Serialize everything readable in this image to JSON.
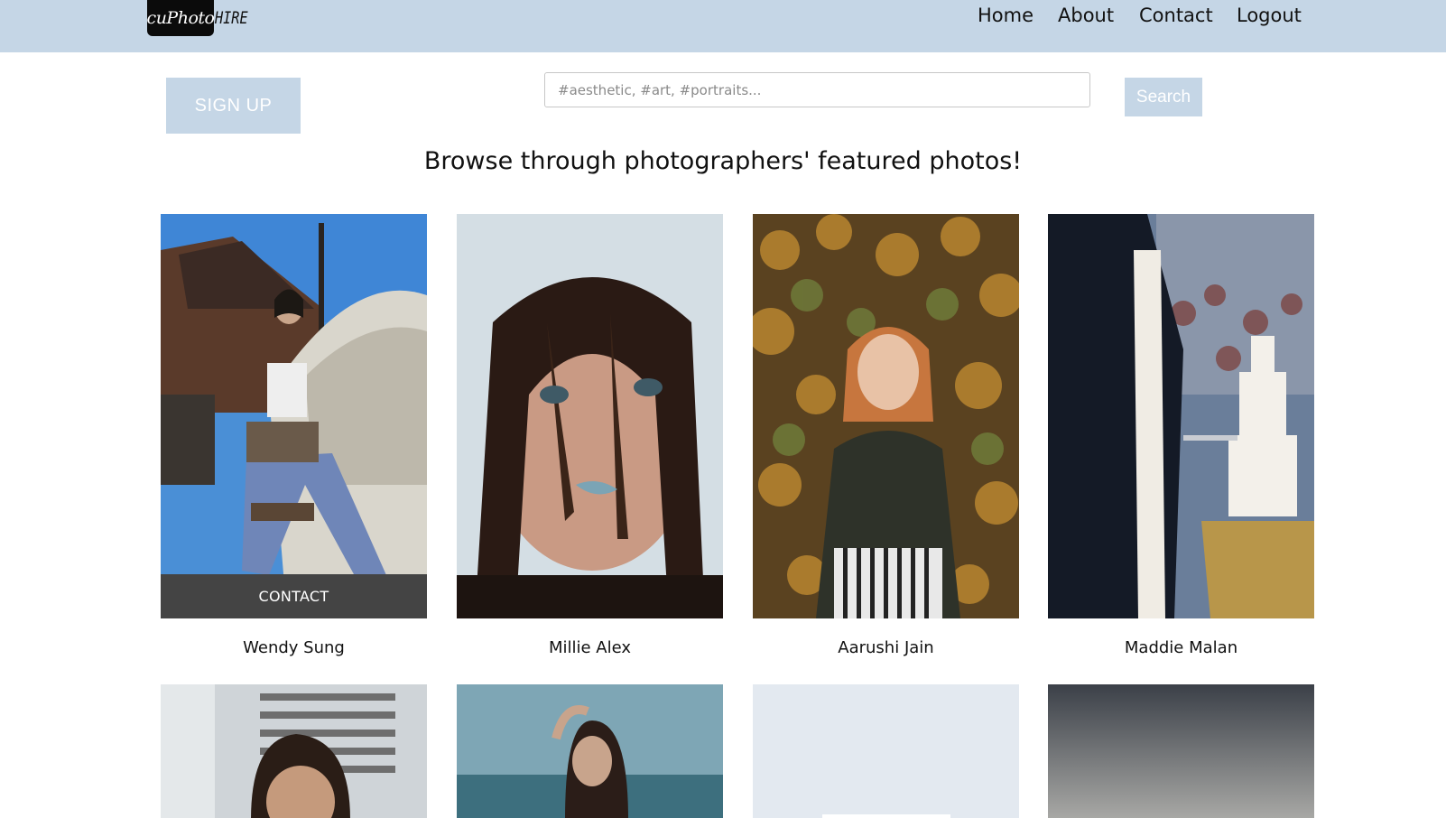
{
  "header": {
    "logo_main": "cuPhoto",
    "logo_suffix": "HIRE",
    "nav": {
      "home": "Home",
      "about": "About",
      "contact": "Contact",
      "logout": "Logout"
    }
  },
  "toolbar": {
    "signup_label": "SIGN UP",
    "search_placeholder": "#aesthetic, #art, #portraits...",
    "search_label": "Search"
  },
  "main": {
    "title": "Browse through photographers' featured photos!",
    "photographers": [
      {
        "name": "Wendy Sung",
        "action": "CONTACT"
      },
      {
        "name": "Millie Alex"
      },
      {
        "name": "Aarushi Jain"
      },
      {
        "name": "Maddie Malan"
      }
    ]
  },
  "colors": {
    "accent": "#c5d6e6",
    "overlay": "#444444"
  }
}
